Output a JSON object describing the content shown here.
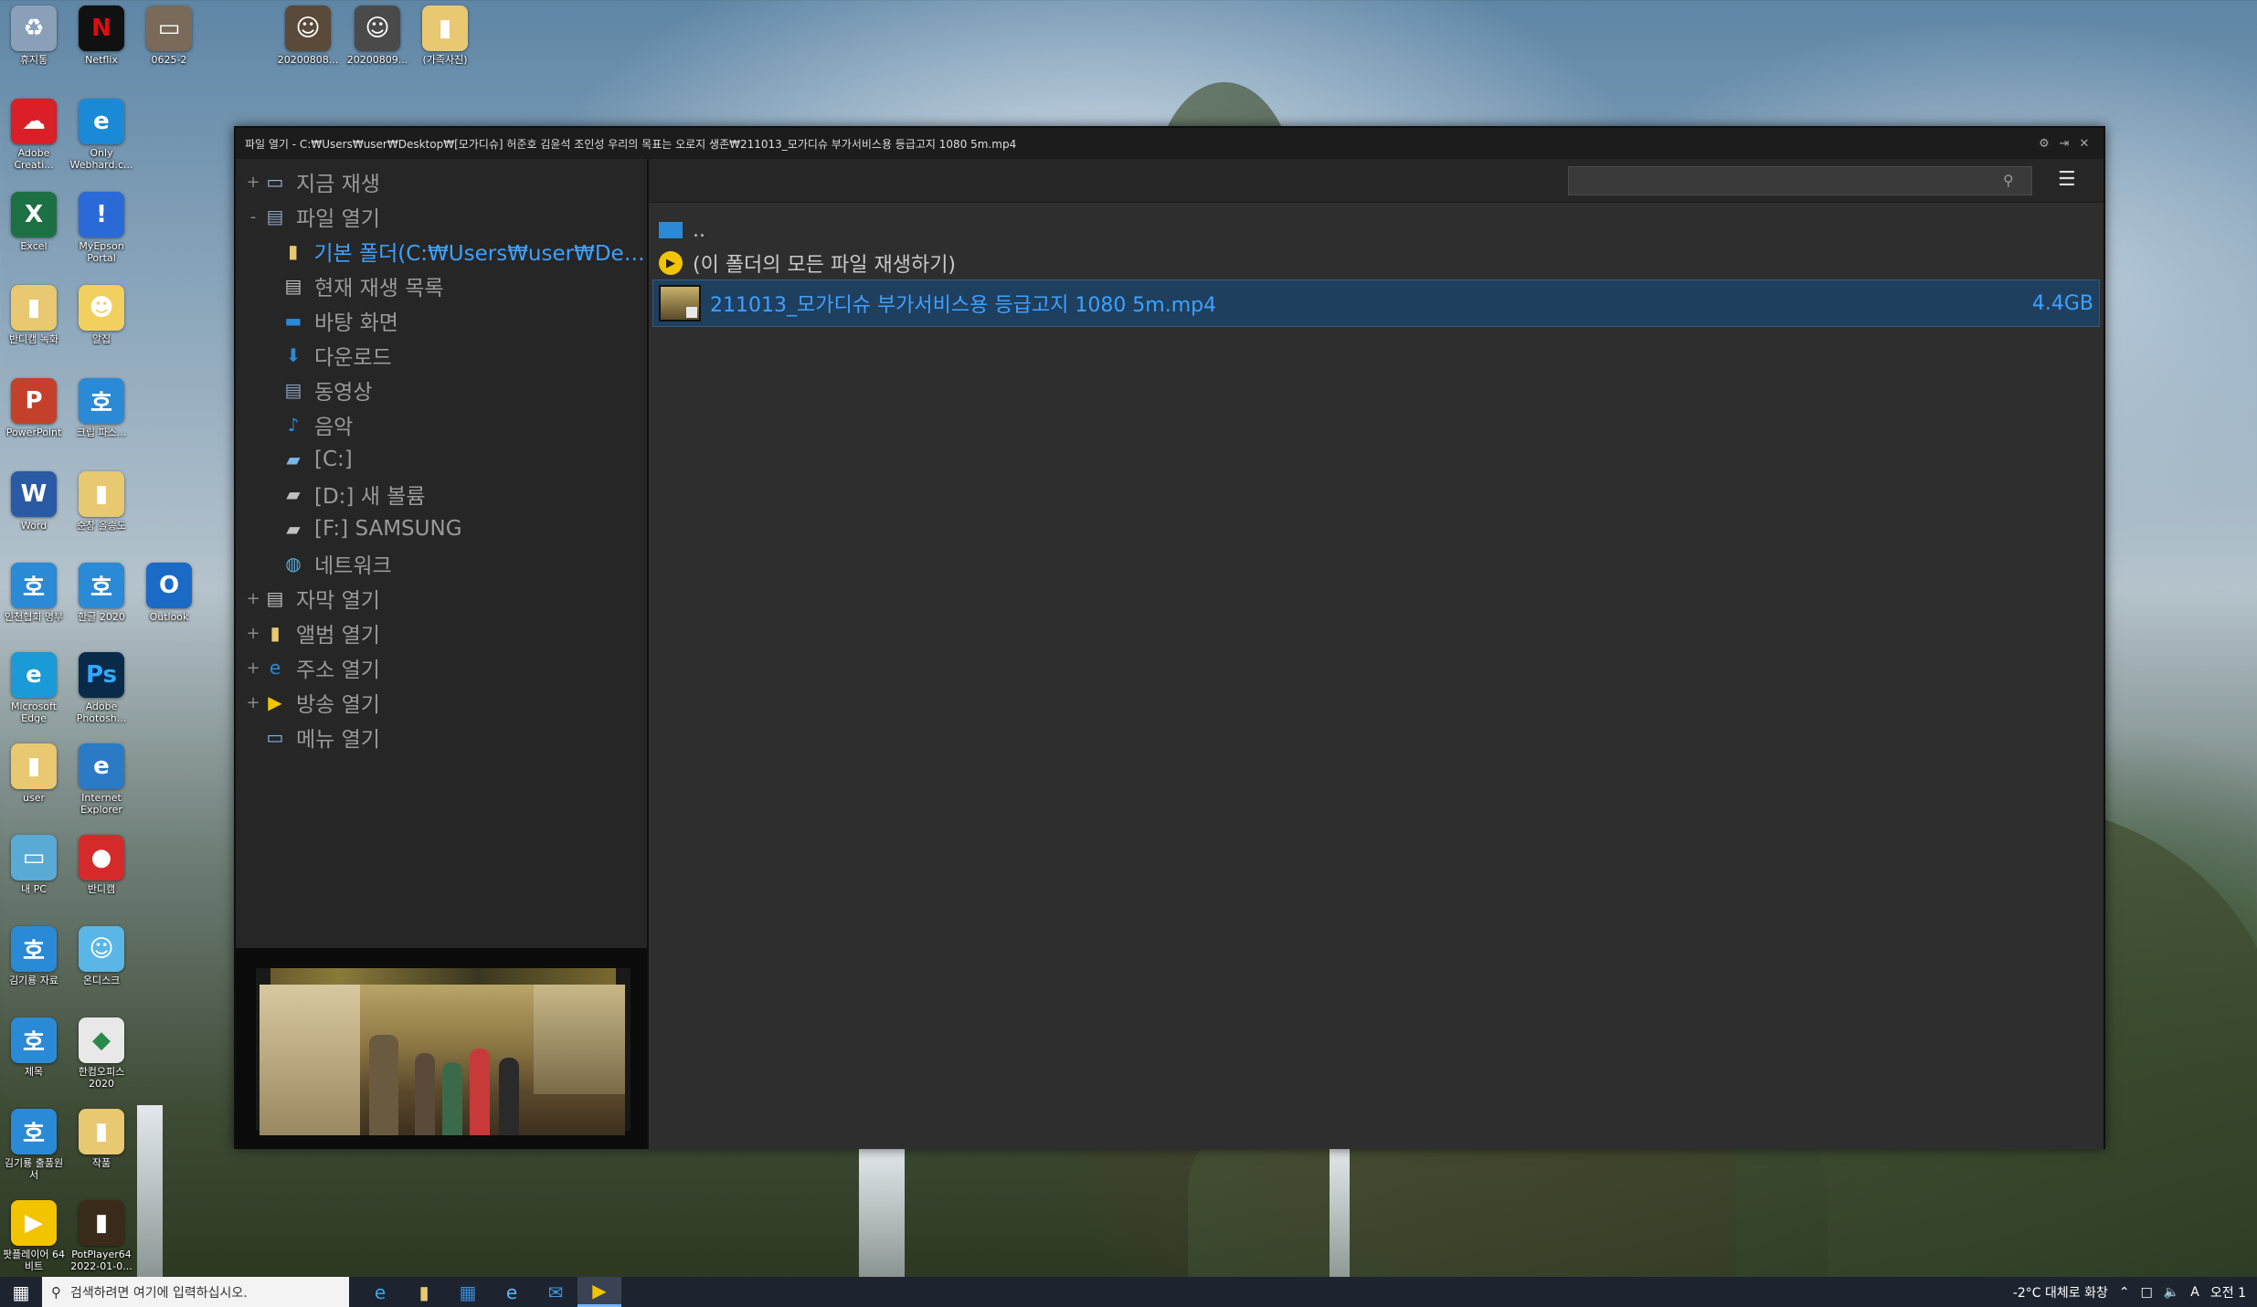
{
  "desktop": {
    "icons": [
      {
        "label": "휴지통",
        "glyph": "♻",
        "bg": "#8aa0b8"
      },
      {
        "label": "Netflix",
        "glyph": "N",
        "bg": "#111111",
        "fg": "#e50914"
      },
      {
        "label": "0625-2",
        "glyph": "▭",
        "bg": "#7a6a5a"
      },
      {
        "label": "20200808...",
        "glyph": "☺",
        "bg": "#5a4a3a"
      },
      {
        "label": "20200809...",
        "glyph": "☺",
        "bg": "#4a4a4a"
      },
      {
        "label": "(가족사진)",
        "glyph": "▮",
        "bg": "#e8c870"
      },
      {
        "label": "Adobe Creati...",
        "glyph": "☁",
        "bg": "#da1f26"
      },
      {
        "label": "Only Webhard.c...",
        "glyph": "e",
        "bg": "#1b8ad6"
      },
      {
        "label": "Excel",
        "glyph": "X",
        "bg": "#1d7044"
      },
      {
        "label": "MyEpson Portal",
        "glyph": "!",
        "bg": "#2a6ad6"
      },
      {
        "label": "반디캠 녹화",
        "glyph": "▮",
        "bg": "#e8c870"
      },
      {
        "label": "알집",
        "glyph": "☻",
        "bg": "#f2d060"
      },
      {
        "label": "PowerPoint",
        "glyph": "P",
        "bg": "#c4402a"
      },
      {
        "label": "크립 파스...",
        "glyph": "호",
        "bg": "#2a8ad6"
      },
      {
        "label": "Word",
        "glyph": "W",
        "bg": "#2a5aa6"
      },
      {
        "label": "순창 올송도",
        "glyph": "▮",
        "bg": "#e8c870"
      },
      {
        "label": "인천협회 명부",
        "glyph": "호",
        "bg": "#2a8ad6"
      },
      {
        "label": "한글 2020",
        "glyph": "호",
        "bg": "#2a8ad6"
      },
      {
        "label": "Outlook",
        "glyph": "O",
        "bg": "#1a6ac6"
      },
      {
        "label": "Microsoft Edge",
        "glyph": "e",
        "bg": "#1a9ad6"
      },
      {
        "label": "Adobe Photosh...",
        "glyph": "Ps",
        "bg": "#0a2a4a",
        "fg": "#31a8ff"
      },
      {
        "label": "user",
        "glyph": "▮",
        "bg": "#e8c870"
      },
      {
        "label": "Internet Explorer",
        "glyph": "e",
        "bg": "#2a7ac6"
      },
      {
        "label": "내 PC",
        "glyph": "▭",
        "bg": "#5aaad6"
      },
      {
        "label": "반디캠",
        "glyph": "●",
        "bg": "#d62a2a"
      },
      {
        "label": "김기룡 자료",
        "glyph": "호",
        "bg": "#2a8ad6"
      },
      {
        "label": "온디스크",
        "glyph": "☺",
        "bg": "#5ab6e6"
      },
      {
        "label": "제목",
        "glyph": "호",
        "bg": "#2a8ad6"
      },
      {
        "label": "한컴오피스 2020",
        "glyph": "◆",
        "bg": "#e8e8e8",
        "fg": "#2a8a4a"
      },
      {
        "label": "김기룡 출품원서",
        "glyph": "호",
        "bg": "#2a8ad6"
      },
      {
        "label": "작품",
        "glyph": "▮",
        "bg": "#e8c870"
      },
      {
        "label": "팟플레이어 64 비트",
        "glyph": "▶",
        "bg": "#f2c400"
      },
      {
        "label": "PotPlayer64 2022-01-0...",
        "glyph": "▮",
        "bg": "#3a2a1a"
      }
    ]
  },
  "window": {
    "title": "파일 열기 - C:₩Users₩user₩Desktop₩[모가디슈] 허준호 김윤석 조인성 우리의 목표는 오로지 생존₩211013_모가디슈 부가서비스용 등급고지 1080 5m.mp4",
    "buttons": {
      "settings": "⚙",
      "pin": "⇥",
      "close": "✕"
    }
  },
  "tree": [
    {
      "label": "지금 재생",
      "expander": "+",
      "icon": "▭",
      "iconColor": "#9ab4d4",
      "child": false,
      "active": false
    },
    {
      "label": "파일 열기",
      "expander": "-",
      "icon": "▤",
      "iconColor": "#8aa0c0",
      "child": false,
      "active": false
    },
    {
      "label": "기본 폴더(C:₩Users₩user₩Des...",
      "expander": "",
      "icon": "▮",
      "iconColor": "#e8c870",
      "child": true,
      "active": true
    },
    {
      "label": "현재 재생 목록",
      "expander": "",
      "icon": "▤",
      "iconColor": "#c0c0c0",
      "child": true,
      "active": false
    },
    {
      "label": "바탕 화면",
      "expander": "",
      "icon": "▬",
      "iconColor": "#2a8ad6",
      "child": true,
      "active": false
    },
    {
      "label": "다운로드",
      "expander": "",
      "icon": "⬇",
      "iconColor": "#2a8ad6",
      "child": true,
      "active": false
    },
    {
      "label": "동영상",
      "expander": "",
      "icon": "▤",
      "iconColor": "#8aa0c0",
      "child": true,
      "active": false
    },
    {
      "label": "음악",
      "expander": "",
      "icon": "♪",
      "iconColor": "#2a8ad6",
      "child": true,
      "active": false
    },
    {
      "label": "[C:]",
      "expander": "",
      "icon": "▰",
      "iconColor": "#7ab6e6",
      "child": true,
      "active": false
    },
    {
      "label": "[D:] 새 볼륨",
      "expander": "",
      "icon": "▰",
      "iconColor": "#c0c0c0",
      "child": true,
      "active": false
    },
    {
      "label": "[F:] SAMSUNG",
      "expander": "",
      "icon": "▰",
      "iconColor": "#c0c0c0",
      "child": true,
      "active": false
    },
    {
      "label": "네트워크",
      "expander": "",
      "icon": "◍",
      "iconColor": "#5aaad6",
      "child": true,
      "active": false
    },
    {
      "label": "자막 열기",
      "expander": "+",
      "icon": "▤",
      "iconColor": "#c0c0c0",
      "child": false,
      "active": false
    },
    {
      "label": "앨범 열기",
      "expander": "+",
      "icon": "▮",
      "iconColor": "#e8c870",
      "child": false,
      "active": false
    },
    {
      "label": "주소 열기",
      "expander": "+",
      "icon": "e",
      "iconColor": "#2a8ad6",
      "child": false,
      "active": false
    },
    {
      "label": "방송 열기",
      "expander": "+",
      "icon": "▶",
      "iconColor": "#f2c400",
      "child": false,
      "active": false
    },
    {
      "label": "메뉴 열기",
      "expander": "",
      "icon": "▭",
      "iconColor": "#7ab6e6",
      "child": false,
      "active": false
    }
  ],
  "browser": {
    "search": {
      "value": "",
      "placeholder": ""
    },
    "rows": [
      {
        "label": "..",
        "type": "parent",
        "size": ""
      },
      {
        "label": "(이 폴더의 모든 파일 재생하기)",
        "type": "playall",
        "size": ""
      },
      {
        "label": "211013_모가디슈 부가서비스용 등급고지 1080 5m.mp4",
        "type": "file",
        "size": "4.4GB"
      }
    ]
  },
  "taskbar": {
    "search_text": "검색하려면 여기에 입력하십시오.",
    "apps": [
      {
        "name": "edge",
        "glyph": "e",
        "color": "#3aa6e6"
      },
      {
        "name": "explorer",
        "glyph": "▮",
        "color": "#e8c870"
      },
      {
        "name": "store",
        "glyph": "▦",
        "color": "#3a8ad6"
      },
      {
        "name": "ie",
        "glyph": "e",
        "color": "#5ab6f6"
      },
      {
        "name": "mail",
        "glyph": "✉",
        "color": "#3a9ae6"
      },
      {
        "name": "potplayer",
        "glyph": "▶",
        "color": "#f2c400"
      }
    ],
    "weather": "-2°C  대체로 화창",
    "ime": "A",
    "time": "오전 1"
  }
}
